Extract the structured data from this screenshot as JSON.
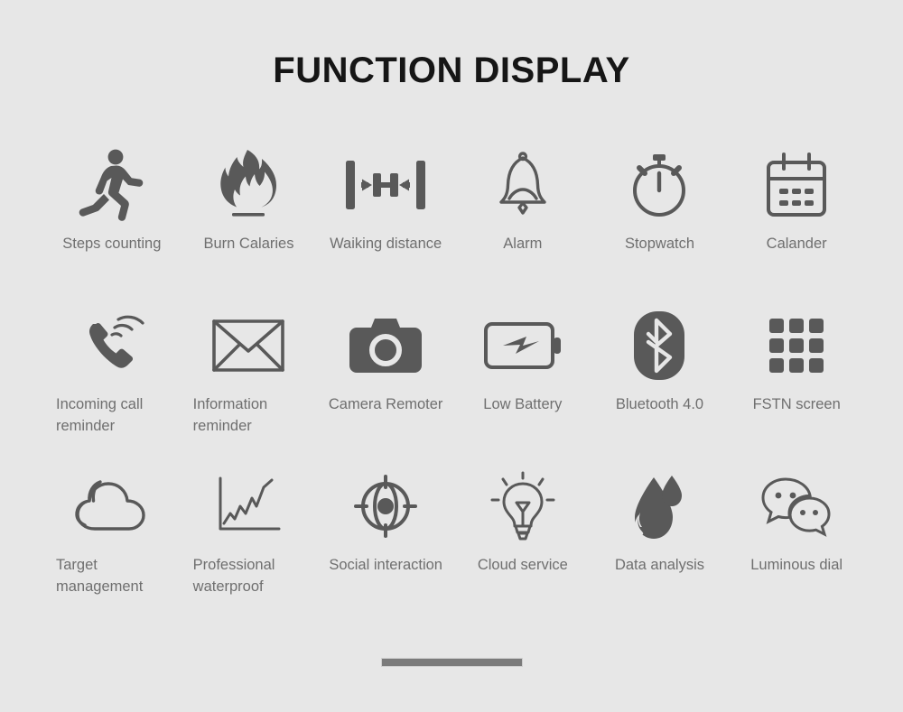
{
  "page": {
    "title": "FUNCTION DISPLAY",
    "background_color": "#e7e7e7",
    "title_color": "#161616",
    "label_color": "#6f6f6f",
    "icon_color": "#595959"
  },
  "features": [
    {
      "icon": "running-person-icon",
      "label": "Steps counting"
    },
    {
      "icon": "flame-icon",
      "label": "Burn Calaries"
    },
    {
      "icon": "distance-measure-icon",
      "label": "Waiking distance"
    },
    {
      "icon": "bell-icon",
      "label": "Alarm"
    },
    {
      "icon": "stopwatch-icon",
      "label": "Stopwatch"
    },
    {
      "icon": "calendar-icon",
      "label": "Calander"
    },
    {
      "icon": "ringing-phone-icon",
      "label": "Incoming call\nreminder"
    },
    {
      "icon": "envelope-icon",
      "label": "Information\nreminder"
    },
    {
      "icon": "camera-icon",
      "label": "Camera Remoter"
    },
    {
      "icon": "battery-bolt-icon",
      "label": "Low Battery"
    },
    {
      "icon": "bluetooth-icon",
      "label": "Bluetooth 4.0"
    },
    {
      "icon": "grid-squares-icon",
      "label": "FSTN screen"
    },
    {
      "icon": "cloud-icon",
      "label": "Target\nmanagement"
    },
    {
      "icon": "line-chart-icon",
      "label": "Professional\nwaterproof"
    },
    {
      "icon": "crosshair-target-icon",
      "label": "Social interaction"
    },
    {
      "icon": "lightbulb-icon",
      "label": "Cloud service"
    },
    {
      "icon": "water-drop-icon",
      "label": "Data analysis"
    },
    {
      "icon": "chat-bubbles-icon",
      "label": "Luminous dial"
    }
  ],
  "home_indicator": {
    "name": "home-indicator-bar",
    "color": "#7b7b7b"
  }
}
